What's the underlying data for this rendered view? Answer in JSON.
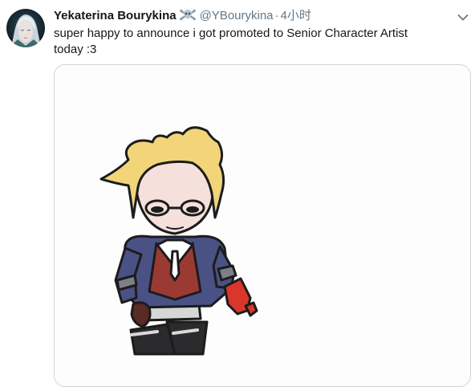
{
  "tweet": {
    "author": {
      "display_name": "Yekaterina Bourykina",
      "badge_icon": "skull-crossbones-icon",
      "handle": "@YBourykina"
    },
    "separator": "·",
    "timestamp": "4小时",
    "text_lines": [
      "super happy to announce i got promoted to Senior Character Artist",
      "today :3"
    ],
    "media": {
      "kind": "image",
      "description_icon": "chibi-character-illustration"
    },
    "menu_icon": "chevron-down-icon"
  },
  "colors": {
    "text_primary": "#14171a",
    "text_secondary": "#657786",
    "media_border": "#ccd6dd",
    "hair": "#f2d479",
    "jacket": "#4a5185",
    "vest": "#9a3a33",
    "glove": "#d9372b"
  }
}
